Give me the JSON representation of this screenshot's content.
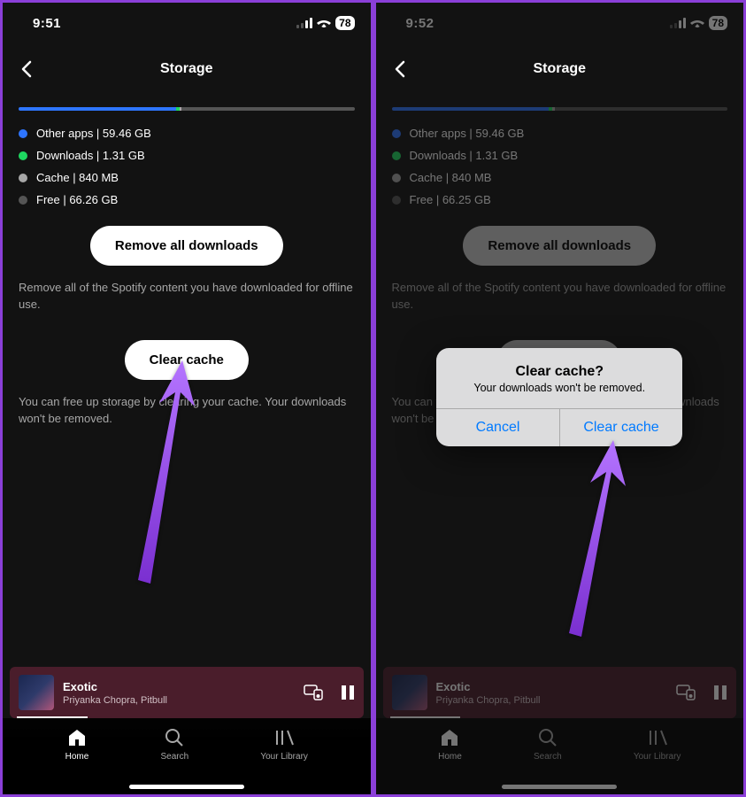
{
  "left": {
    "status": {
      "time": "9:51",
      "battery": "78"
    },
    "header": {
      "title": "Storage"
    },
    "storage": {
      "legend": {
        "apps": "Other apps | 59.46 GB",
        "downloads": "Downloads | 1.31 GB",
        "cache": "Cache | 840 MB",
        "free": "Free | 66.26 GB"
      }
    },
    "buttons": {
      "removeDownloads": "Remove all downloads",
      "clearCache": "Clear cache"
    },
    "helpers": {
      "downloads": "Remove all of the Spotify content you have downloaded for offline use.",
      "cache": "You can free up storage by clearing your cache. Your downloads won't be removed."
    }
  },
  "right": {
    "status": {
      "time": "9:52",
      "battery": "78"
    },
    "header": {
      "title": "Storage"
    },
    "storage": {
      "legend": {
        "apps": "Other apps | 59.46 GB",
        "downloads": "Downloads | 1.31 GB",
        "cache": "Cache | 840 MB",
        "free": "Free | 66.25 GB"
      }
    },
    "buttons": {
      "removeDownloads": "Remove all downloads",
      "clearCache": "Clear cache"
    },
    "helpers": {
      "downloads": "Remove all of the Spotify content you have downloaded for offline use.",
      "cache": "You can free up storage by clearing your cache. Your downloads won't be removed."
    },
    "dialog": {
      "title": "Clear cache?",
      "message": "Your downloads won't be removed.",
      "cancel": "Cancel",
      "confirm": "Clear cache"
    }
  },
  "nowPlaying": {
    "title": "Exotic",
    "artist": "Priyanka Chopra, Pitbull"
  },
  "nav": {
    "home": "Home",
    "search": "Search",
    "library": "Your Library"
  }
}
